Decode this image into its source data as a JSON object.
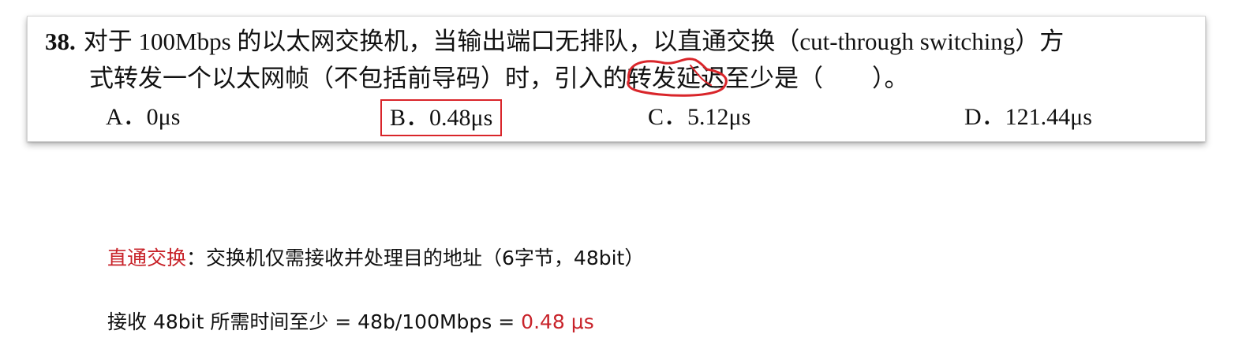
{
  "question": {
    "number": "38.",
    "line1": "对于 100Mbps 的以太网交换机，当输出端口无排队，以直通交换（cut-through switching）方",
    "line2_before": "式转发一个以太网帧（不包括前导码）时，引入的",
    "line2_highlight": "转发延迟",
    "line2_after": "至少是（　　）。",
    "options": [
      {
        "label": "A．0μs",
        "selected": false
      },
      {
        "label": "B．0.48μs",
        "selected": true
      },
      {
        "label": "C．5.12μs",
        "selected": false
      },
      {
        "label": "D．121.44μs",
        "selected": false
      }
    ]
  },
  "notes": {
    "line1_term": "直通交换",
    "line1_text": "：交换机仅需接收并处理目的地址（6字节，48bit）",
    "line2_text": "接收 48bit 所需时间至少 = 48b/100Mbps = ",
    "line2_result": "0.48 μs"
  },
  "colors": {
    "accent_red": "#c8232a",
    "answer_box": "#d9252a"
  }
}
